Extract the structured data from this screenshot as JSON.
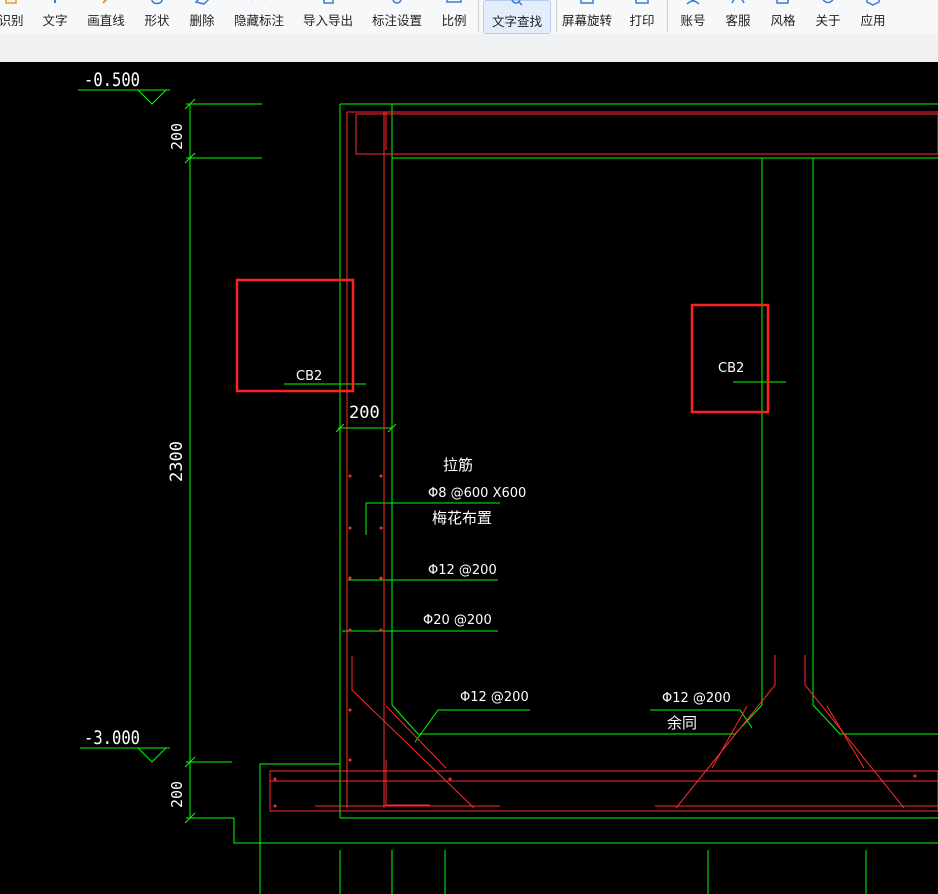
{
  "toolbar": {
    "items": [
      {
        "label": "识别",
        "icon": "recognize-icon"
      },
      {
        "label": "文字",
        "icon": "text-icon"
      },
      {
        "label": "画直线",
        "icon": "pencil-line-icon"
      },
      {
        "label": "形状",
        "icon": "shape-icon"
      },
      {
        "label": "删除",
        "icon": "eraser-icon"
      },
      {
        "label": "隐藏标注",
        "icon": "eye-icon"
      },
      {
        "label": "导入导出",
        "icon": "import-export-icon"
      },
      {
        "label": "标注设置",
        "icon": "settings-icon"
      },
      {
        "label": "比例",
        "icon": "ruler-icon"
      },
      {
        "label": "文字查找",
        "icon": "search-icon",
        "active": true
      },
      {
        "label": "屏幕旋转",
        "icon": "rotate-screen-icon"
      },
      {
        "label": "打印",
        "icon": "printer-icon"
      },
      {
        "label": "账号",
        "icon": "user-icon"
      },
      {
        "label": "客服",
        "icon": "headset-icon"
      },
      {
        "label": "风格",
        "icon": "style-edit-icon"
      },
      {
        "label": "关于",
        "icon": "info-icon"
      },
      {
        "label": "应用",
        "icon": "app-box-icon"
      }
    ]
  },
  "drawing": {
    "elevation_top": "-0.500",
    "elevation_bottom": "-3.000",
    "dim_top": "200",
    "dim_mid": "2300",
    "dim_bottom": "200",
    "dim_wall": "200",
    "label_cb2_left": "CB2",
    "label_cb2_right": "CB2",
    "note_tie_bar": "拉筋",
    "note_tie_spec": "Φ8 @600 X600",
    "note_tie_layout": "梅花布置",
    "note_rebar_1": "Φ12 @200",
    "note_rebar_2": "Φ20 @200",
    "note_rebar_3": "Φ12 @200",
    "note_rebar_4": "Φ12 @200",
    "note_rebar_4_sub": "余同"
  },
  "colors": {
    "background": "#000000",
    "structure_line": "#00ff00",
    "rebar_line": "#ff0000",
    "text": "#ffffff",
    "highlight_box": "#ff2020",
    "toolbar_bg": "#f7f8fa"
  }
}
